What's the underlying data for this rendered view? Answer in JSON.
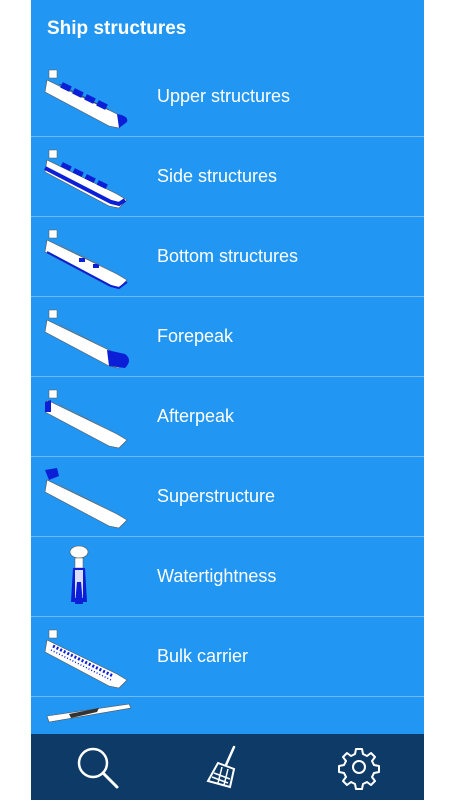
{
  "header": {
    "title": "Ship structures"
  },
  "items": [
    {
      "label": "Upper structures",
      "icon": "ship-upper-structures-icon"
    },
    {
      "label": "Side structures",
      "icon": "ship-side-structures-icon"
    },
    {
      "label": "Bottom structures",
      "icon": "ship-bottom-structures-icon"
    },
    {
      "label": "Forepeak",
      "icon": "ship-forepeak-icon"
    },
    {
      "label": "Afterpeak",
      "icon": "ship-afterpeak-icon"
    },
    {
      "label": "Superstructure",
      "icon": "ship-superstructure-icon"
    },
    {
      "label": "Watertightness",
      "icon": "watertight-door-icon"
    },
    {
      "label": "Bulk carrier",
      "icon": "bulk-carrier-icon"
    },
    {
      "label": "",
      "icon": "partial-ship-icon"
    }
  ],
  "bottom_nav": {
    "search": "search-icon",
    "clean": "broom-icon",
    "settings": "gear-icon"
  },
  "colors": {
    "background": "#2196f3",
    "bottom_bar": "#0d3a66",
    "highlight": "#0a1fd6"
  }
}
